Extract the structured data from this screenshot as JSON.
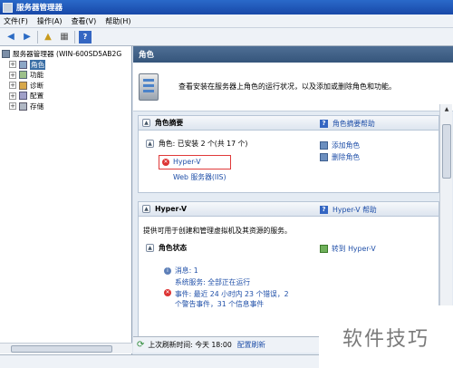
{
  "window": {
    "title": "服务器管理器"
  },
  "menu": [
    "文件(F)",
    "操作(A)",
    "查看(V)",
    "帮助(H)"
  ],
  "tree": {
    "root": "服务器管理器 (WIN-600SD5AB2G",
    "items": [
      "角色",
      "功能",
      "诊断",
      "配置",
      "存储"
    ]
  },
  "pane": {
    "header": "角色",
    "intro": "查看安装在服务器上角色的运行状况，以及添加或删除角色和功能。"
  },
  "summary": {
    "title": "角色摘要",
    "help": "角色摘要帮助",
    "roles_line": "角色: 已安装 2 个(共 17 个)",
    "role1": "Hyper-V",
    "role2": "Web 服务器(IIS)",
    "add_roles": "添加角色",
    "remove_roles": "删除角色"
  },
  "hyperv": {
    "title": "Hyper-V",
    "help": "Hyper-V 帮助",
    "desc": "提供可用于创建和管理虚拟机及其资源的服务。",
    "status_title": "角色状态",
    "goto": "转到 Hyper-V",
    "messages": "消息: 1",
    "services": "系统服务: 全部正在运行",
    "events": "事件: 最近 24 小时内 23 个错误，2",
    "events2": "个警告事件，31 个信息事件"
  },
  "status": {
    "refresh_label": "上次刷新时间: 今天 18:00",
    "configure": "配置刷新"
  },
  "watermark": "软件技巧"
}
